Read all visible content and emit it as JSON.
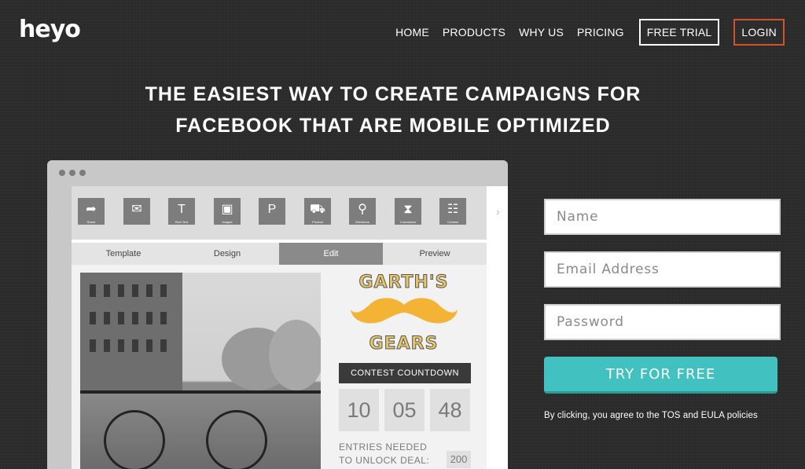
{
  "brand": {
    "logo": "heyo"
  },
  "nav": {
    "links": [
      "HOME",
      "PRODUCTS",
      "WHY US",
      "PRICING"
    ],
    "free_trial": "FREE TRIAL",
    "login": "LOGIN",
    "login_border_color": "#d2522b"
  },
  "hero": {
    "line1": "THE EASIEST WAY TO CREATE CAMPAIGNS FOR",
    "line2": "FACEBOOK THAT ARE MOBILE OPTIMIZED"
  },
  "mockup": {
    "tools": [
      {
        "label": "Share",
        "icon": "share-icon"
      },
      {
        "label": "",
        "icon": "mail-icon"
      },
      {
        "label": "Rich Text",
        "icon": "text-icon"
      },
      {
        "label": "Images",
        "icon": "image-icon"
      },
      {
        "label": "",
        "icon": "paypal-icon"
      },
      {
        "label": "Product",
        "icon": "cart-icon"
      },
      {
        "label": "Directions",
        "icon": "map-pin-icon"
      },
      {
        "label": "Countdown",
        "icon": "hourglass-icon"
      },
      {
        "label": "Contact",
        "icon": "contact-book-icon"
      }
    ],
    "steps": [
      "Template",
      "Design",
      "Edit",
      "Preview"
    ],
    "active_step": "Edit",
    "brand_top": "GARTH'S",
    "brand_bottom": "GEARS",
    "countdown_title": "CONTEST COUNTDOWN",
    "countdown": [
      "10",
      "05",
      "48"
    ],
    "entries_line1": "ENTRIES NEEDED",
    "entries_line2": "TO UNLOCK DEAL:",
    "entries_value": "200"
  },
  "form": {
    "name_placeholder": "Name",
    "email_placeholder": "Email Address",
    "password_placeholder": "Password",
    "cta": "TRY FOR FREE",
    "cta_color": "#41c1bf",
    "terms": "By clicking, you agree to the TOS and EULA policies"
  }
}
